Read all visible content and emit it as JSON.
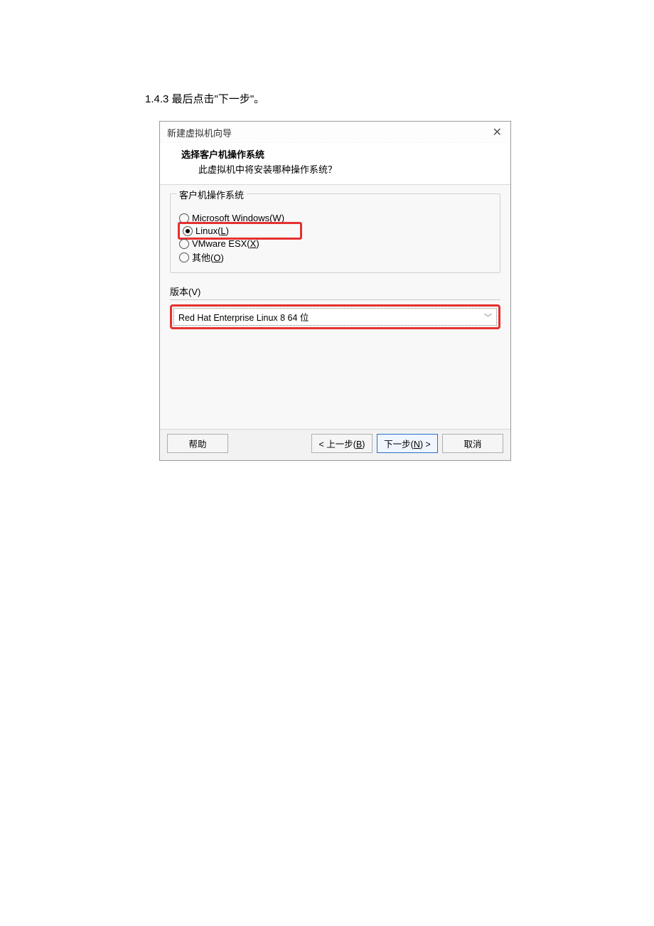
{
  "caption": "1.4.3 最后点击\"下一步\"。",
  "dialog": {
    "title": "新建虚拟机向导",
    "header_title": "选择客户机操作系统",
    "header_sub": "此虚拟机中将安装哪种操作系统？",
    "os_group_label": "客户机操作系统",
    "os_options": {
      "windows": {
        "label": "Microsoft Windows(",
        "mn": "W",
        "suffix": ")"
      },
      "linux": {
        "label": "Linux(",
        "mn": "L",
        "suffix": ")"
      },
      "vmware": {
        "label": "VMware ESX(",
        "mn": "X",
        "suffix": ")"
      },
      "other": {
        "label": "其他(",
        "mn": "O",
        "suffix": ")"
      }
    },
    "version_label": "版本(V)",
    "version_value": "Red Hat Enterprise Linux 8 64 位",
    "buttons": {
      "help": "帮助",
      "back_pre": "< 上一步(",
      "back_mn": "B",
      "back_post": ")",
      "next_pre": "下一步(",
      "next_mn": "N",
      "next_post": ") >",
      "cancel": "取消"
    }
  }
}
